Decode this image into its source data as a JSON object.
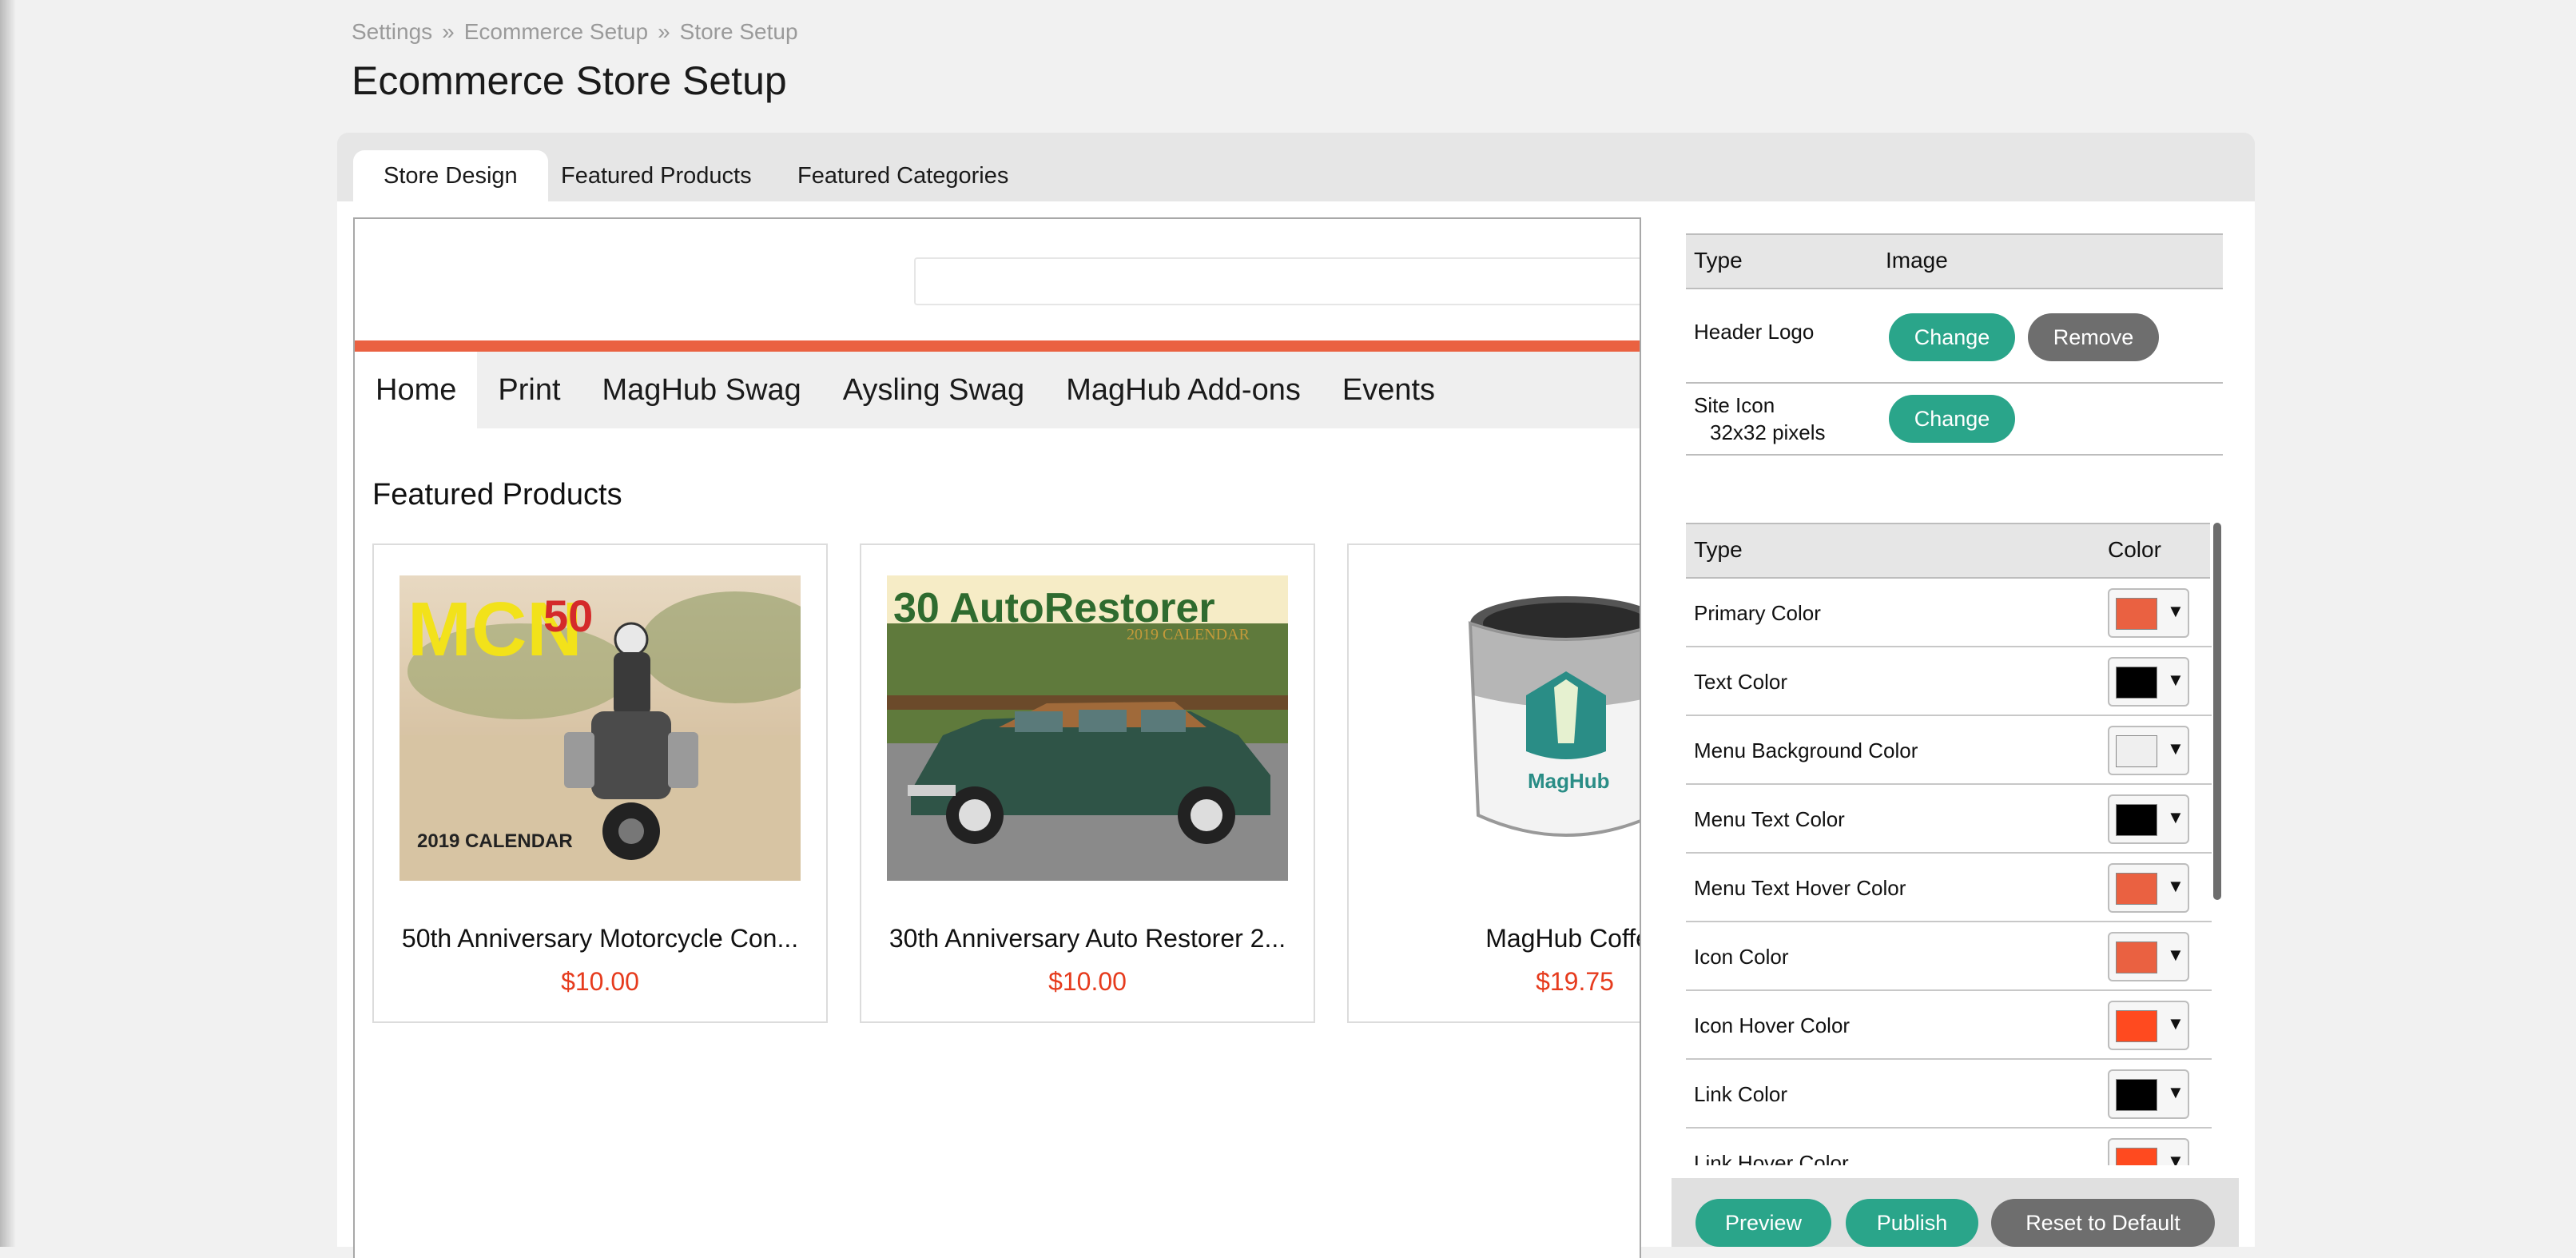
{
  "breadcrumb": {
    "items": [
      "Settings",
      "Ecommerce Setup",
      "Store Setup"
    ],
    "separator": "»"
  },
  "page": {
    "title": "Ecommerce Store Setup"
  },
  "tabs": [
    {
      "label": "Store Design",
      "active": true
    },
    {
      "label": "Featured Products",
      "active": false
    },
    {
      "label": "Featured Categories",
      "active": false
    }
  ],
  "preview": {
    "accent_color": "#ea6141",
    "nav": [
      {
        "label": "Home",
        "active": true
      },
      {
        "label": "Print",
        "active": false
      },
      {
        "label": "MagHub Swag",
        "active": false
      },
      {
        "label": "Aysling Swag",
        "active": false
      },
      {
        "label": "MagHub Add-ons",
        "active": false
      },
      {
        "label": "Events",
        "active": false
      }
    ],
    "featured_heading": "Featured Products",
    "products": [
      {
        "name": "50th Anniversary Motorcycle Con...",
        "price": "$10.00",
        "image_text": "MCN",
        "image_badge": "50",
        "image_caption": "2019 CALENDAR"
      },
      {
        "name": "30th Anniversary Auto Restorer 2...",
        "price": "$10.00",
        "image_text": "30 AutoRestorer",
        "image_caption": "2019 CALENDAR"
      },
      {
        "name": "MagHub Coffee",
        "price": "$19.75",
        "image_text": "MagHub"
      }
    ],
    "price_color": "#e63b1d"
  },
  "image_settings": {
    "headers": {
      "type": "Type",
      "image": "Image"
    },
    "rows": [
      {
        "type": "Header Logo",
        "subtext": "",
        "buttons": [
          "Change",
          "Remove"
        ]
      },
      {
        "type": "Site Icon",
        "subtext": "32x32 pixels",
        "buttons": [
          "Change"
        ]
      }
    ]
  },
  "color_settings": {
    "headers": {
      "type": "Type",
      "color": "Color"
    },
    "rows": [
      {
        "label": "Primary Color",
        "color": "#ea6141"
      },
      {
        "label": "Text Color",
        "color": "#000000"
      },
      {
        "label": "Menu Background Color",
        "color": "#efefef"
      },
      {
        "label": "Menu Text Color",
        "color": "#000000"
      },
      {
        "label": "Menu Text Hover Color",
        "color": "#ea6141"
      },
      {
        "label": "Icon Color",
        "color": "#ea6141"
      },
      {
        "label": "Icon Hover Color",
        "color": "#ff4a1f"
      },
      {
        "label": "Link Color",
        "color": "#000000"
      },
      {
        "label": "Link Hover Color",
        "color": "#ff4a1f"
      }
    ]
  },
  "actions": {
    "preview": "Preview",
    "publish": "Publish",
    "reset": "Reset to Default"
  },
  "colors": {
    "teal": "#2aa58a",
    "gray_button": "#6e6e6e"
  }
}
